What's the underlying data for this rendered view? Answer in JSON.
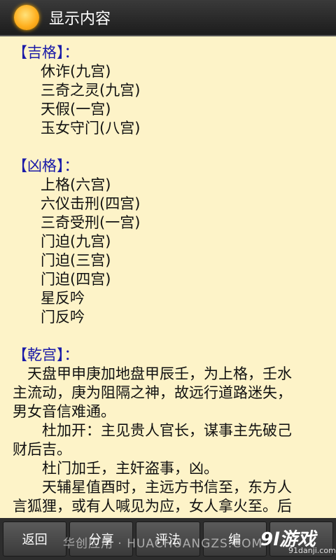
{
  "header": {
    "title": "显示内容"
  },
  "sections": {
    "jige": {
      "heading": "【吉格】：",
      "items": [
        "休诈(九宫)",
        "三奇之灵(九宫)",
        "天假(一宫)",
        "玉女守门(八宫)"
      ]
    },
    "xiongge": {
      "heading": "【凶格】：",
      "items": [
        "上格(六宫)",
        "六仪击刑(四宫)",
        "三奇受刑(一宫)",
        "门迫(九宫)",
        "门迫(三宫)",
        "门迫(四宫)",
        "星反吟",
        "门反吟"
      ]
    },
    "qiangong": {
      "heading": "【乾宫】：",
      "lines": [
        "天盘甲申庚加地盘甲辰壬，为上格，壬水",
        "主流动，庚为阻隔之神，故远行道路迷失，",
        "男女音信难通。",
        "杜加开：主见贵人官长，谋事主先破己",
        "财后吉。",
        "杜门加壬，主奸盗事，凶。",
        "天辅星值酉时，主远方书信至，东方人",
        "言狐狸，或有人喊见为应，女人拿火至。后"
      ]
    }
  },
  "toolbar": {
    "back": "返回",
    "share": "分享",
    "comment": "评法",
    "edit": "编"
  },
  "watermark": "华创应用 · HUACHUANGZS.COM",
  "logo": {
    "main": "9l游戏",
    "sub": "91danji.com"
  }
}
